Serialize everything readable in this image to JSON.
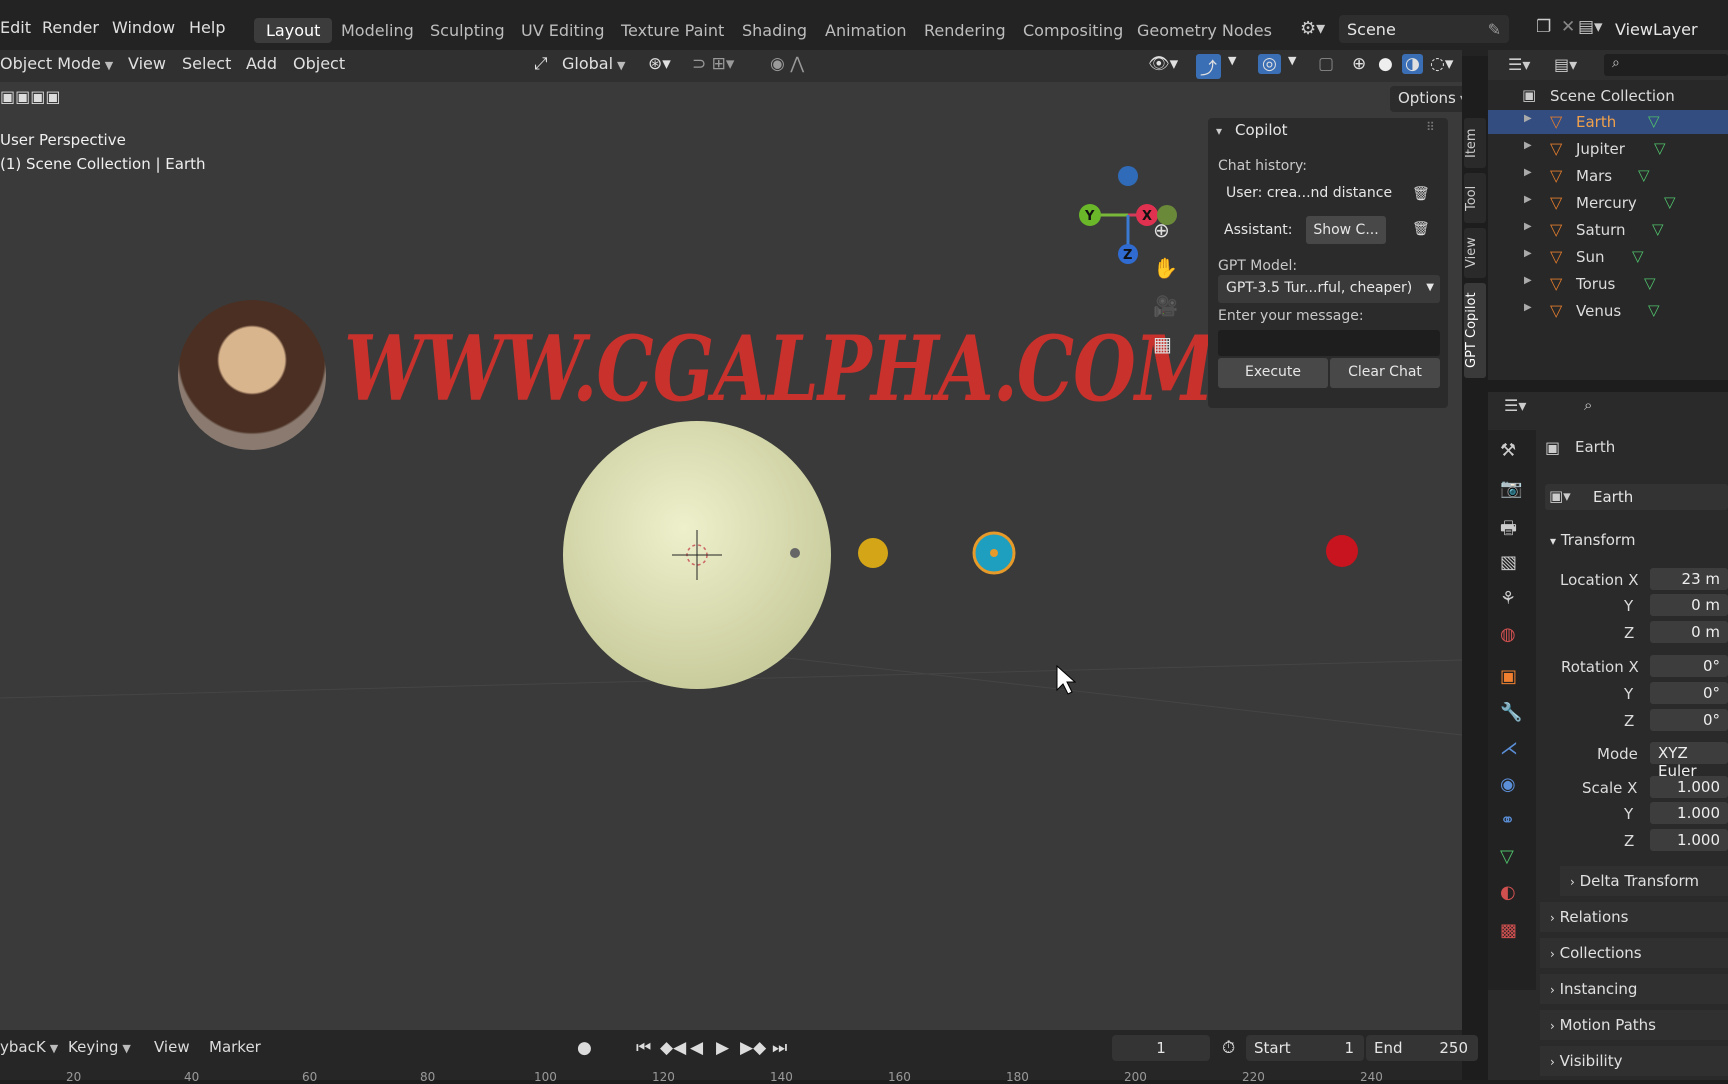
{
  "menu": [
    "Edit",
    "Render",
    "Window",
    "Help"
  ],
  "workspaces": [
    "Layout",
    "Modeling",
    "Sculpting",
    "UV Editing",
    "Texture Paint",
    "Shading",
    "Animation",
    "Rendering",
    "Compositing",
    "Geometry Nodes"
  ],
  "scene_name": "Scene",
  "view_layer": "ViewLayer",
  "viewport": {
    "mode": "Object Mode",
    "menus": [
      "View",
      "Select",
      "Add",
      "Object"
    ],
    "orientation": "Global",
    "options": "Options",
    "info_line1": "User Perspective",
    "info_line2": "(1) Scene Collection | Earth",
    "watermark": "WWW.CGALPHA.COM",
    "gizmo": {
      "y": "Y",
      "x": "X",
      "z": "Z"
    }
  },
  "copilot": {
    "title": "Copilot",
    "chat_history_label": "Chat history:",
    "user_msg": "User: crea...nd distance",
    "assistant_label": "Assistant:",
    "assistant_btn": "Show C...",
    "model_label": "GPT Model:",
    "model_value": "GPT-3.5 Tur...rful, cheaper)",
    "message_label": "Enter your message:",
    "message_value": "",
    "execute": "Execute",
    "clear": "Clear Chat"
  },
  "side_tabs": [
    "Item",
    "Tool",
    "View",
    "GPT Copilot"
  ],
  "outliner": {
    "root": "Scene Collection",
    "items": [
      "Earth",
      "Jupiter",
      "Mars",
      "Mercury",
      "Saturn",
      "Sun",
      "Torus",
      "Venus"
    ],
    "selected": "Earth"
  },
  "properties": {
    "object_name": "Earth",
    "data_name": "Earth",
    "transform": "Transform",
    "location_x_label": "Location X",
    "location_x": "23 m",
    "location_y": "0 m",
    "location_z": "0 m",
    "rotation_x_label": "Rotation X",
    "rotation_x": "0°",
    "rotation_y": "0°",
    "rotation_z": "0°",
    "mode_label": "Mode",
    "mode": "XYZ Euler",
    "scale_x_label": "Scale X",
    "scale_x": "1.000",
    "scale_y": "1.000",
    "scale_z": "1.000",
    "y": "Y",
    "z": "Z",
    "panels": [
      "Delta Transform",
      "Relations",
      "Collections",
      "Instancing",
      "Motion Paths",
      "Visibility"
    ]
  },
  "timeline": {
    "menus": [
      "ybacK",
      "Keying",
      "View",
      "Marker"
    ],
    "current_frame": "1",
    "start_label": "Start",
    "start": "1",
    "end_label": "End",
    "end": "250",
    "ticks": [
      "20",
      "40",
      "60",
      "80",
      "100",
      "120",
      "140",
      "160",
      "180",
      "200",
      "220",
      "240"
    ]
  }
}
